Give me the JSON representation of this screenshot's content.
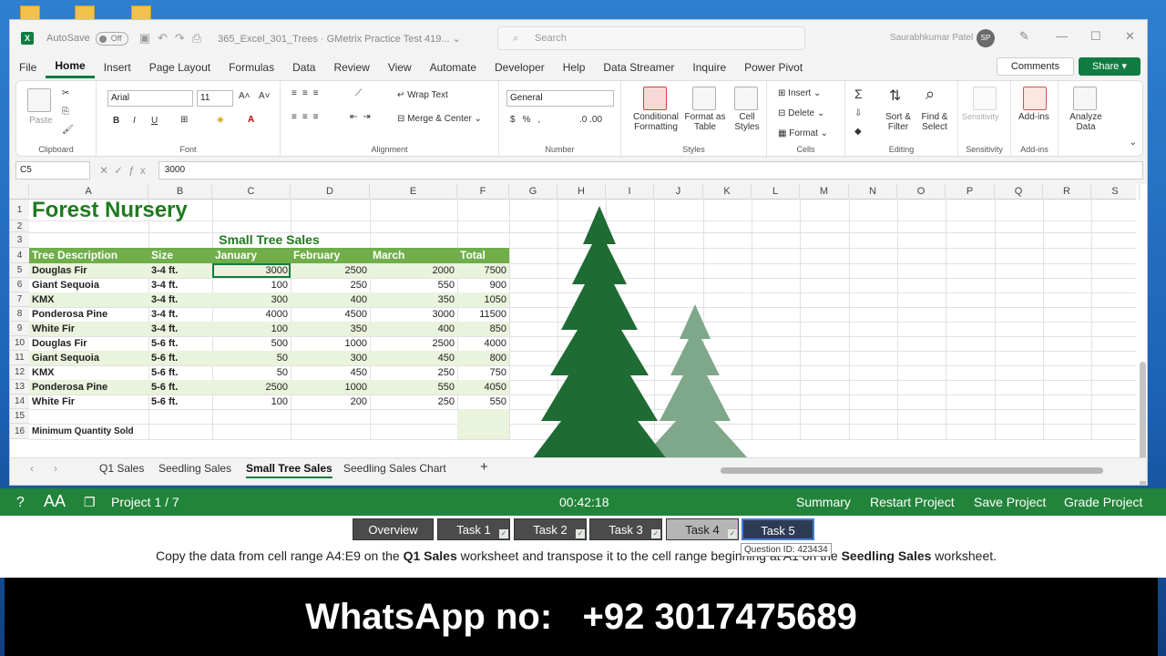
{
  "window": {
    "autosave_label": "AutoSave",
    "autosave_state": "Off",
    "doc_title": "365_Excel_301_Trees  ·  GMetrix Practice Test 419... ⌄",
    "search_placeholder": "Search",
    "user_name": "Saurabhkumar Patel",
    "user_initials": "SP"
  },
  "menu": {
    "tabs": [
      "File",
      "Home",
      "Insert",
      "Page Layout",
      "Formulas",
      "Data",
      "Review",
      "View",
      "Automate",
      "Developer",
      "Help",
      "Data Streamer",
      "Inquire",
      "Power Pivot"
    ],
    "active": "Home",
    "comments": "Comments",
    "share": "Share"
  },
  "ribbon": {
    "clipboard": {
      "paste": "Paste",
      "label": "Clipboard"
    },
    "font": {
      "name": "Arial",
      "size": "11",
      "label": "Font"
    },
    "alignment": {
      "wrap": "Wrap Text",
      "merge": "Merge & Center",
      "label": "Alignment"
    },
    "number": {
      "format": "General",
      "label": "Number"
    },
    "styles": {
      "cond1": "Conditional",
      "cond2": "Formatting",
      "fmt1": "Format as",
      "fmt2": "Table",
      "cell1": "Cell",
      "cell2": "Styles",
      "label": "Styles"
    },
    "cells": {
      "insert": "Insert",
      "delete": "Delete",
      "format": "Format",
      "label": "Cells"
    },
    "editing": {
      "sort1": "Sort &",
      "sort2": "Filter",
      "find1": "Find &",
      "find2": "Select",
      "label": "Editing"
    },
    "sensitivity": {
      "btn": "Sensitivity",
      "label": "Sensitivity"
    },
    "addins": {
      "btn": "Add-ins",
      "label": "Add-ins"
    },
    "analyze": {
      "btn1": "Analyze",
      "btn2": "Data"
    }
  },
  "formula_bar": {
    "name_box": "C5",
    "value": "3000"
  },
  "columns": [
    "A",
    "B",
    "C",
    "D",
    "E",
    "F",
    "G",
    "H",
    "I",
    "J",
    "K",
    "L",
    "M",
    "N",
    "O",
    "P",
    "Q",
    "R",
    "S"
  ],
  "rows": [
    "1",
    "2",
    "3",
    "4",
    "5",
    "6",
    "7",
    "8",
    "9",
    "10",
    "11",
    "12",
    "13",
    "14",
    "15",
    "16"
  ],
  "sheet": {
    "title": "Forest Nursery",
    "subtitle": "Small Tree Sales",
    "headers": [
      "Tree Description",
      "Size",
      "January",
      "February",
      "March",
      "Total"
    ],
    "data": [
      [
        "Douglas Fir",
        "3-4 ft.",
        "3000",
        "2500",
        "2000",
        "7500"
      ],
      [
        "Giant Sequoia",
        "3-4 ft.",
        "100",
        "250",
        "550",
        "900"
      ],
      [
        "KMX",
        "3-4 ft.",
        "300",
        "400",
        "350",
        "1050"
      ],
      [
        "Ponderosa Pine",
        "3-4 ft.",
        "4000",
        "4500",
        "3000",
        "11500"
      ],
      [
        "White Fir",
        "3-4 ft.",
        "100",
        "350",
        "400",
        "850"
      ],
      [
        "Douglas Fir",
        "5-6 ft.",
        "500",
        "1000",
        "2500",
        "4000"
      ],
      [
        "Giant Sequoia",
        "5-6 ft.",
        "50",
        "300",
        "450",
        "800"
      ],
      [
        "KMX",
        "5-6 ft.",
        "50",
        "450",
        "250",
        "750"
      ],
      [
        "Ponderosa Pine",
        "5-6 ft.",
        "2500",
        "1000",
        "550",
        "4050"
      ],
      [
        "White Fir",
        "5-6 ft.",
        "100",
        "200",
        "250",
        "550"
      ]
    ],
    "row16": "Minimum Quantity Sold"
  },
  "sheet_tabs": [
    "Q1 Sales",
    "Seedling Sales",
    "Small Tree Sales",
    "Seedling Sales Chart"
  ],
  "active_sheet": "Small Tree Sales",
  "gmetrix": {
    "project": "Project 1 / 7",
    "timer": "00:42:18",
    "summary": "Summary",
    "restart": "Restart Project",
    "save": "Save Project",
    "grade": "Grade Project",
    "tasks": [
      "Overview",
      "Task 1",
      "Task 2",
      "Task 3",
      "Task 4",
      "Task 5"
    ],
    "tooltip": "Question ID: 423434",
    "instruction_pre": "Copy the data from cell range A4:E9 on the ",
    "instruction_b1": "Q1 Sales",
    "instruction_mid": " worksheet and transpose it to the cell range beginning at A1 on the ",
    "instruction_b2": "Seedling Sales",
    "instruction_post": " worksheet."
  },
  "banner": "WhatsApp no:   +92 3017475689",
  "colors": {
    "excel_green": "#107c41",
    "header_green": "#6fae4a",
    "band_green": "#eaf3dc",
    "gmetrix_green": "#22843a",
    "title_green": "#1f7a1f"
  }
}
